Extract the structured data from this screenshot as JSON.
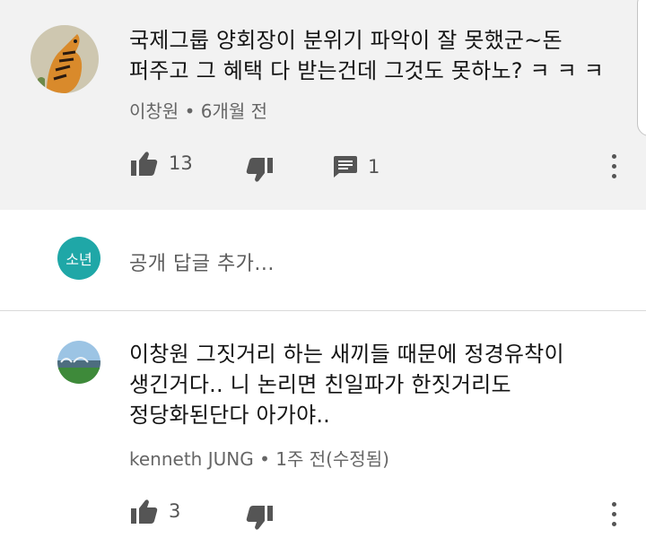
{
  "comment1": {
    "text_line1": "국제그룹 양회장이 분위기 파악이 잘 못했군~돈",
    "text_line2": "퍼주고 그 혜택 다 받는건데 그것도 못하노? ㅋ ㅋ ㅋ",
    "author": "이창원",
    "separator": "•",
    "time": "6개월 전",
    "like_count": "13",
    "reply_count": "1"
  },
  "reply_box": {
    "avatar_text": "소년",
    "placeholder": "공개 답글 추가..."
  },
  "comment2": {
    "text_line1": "이창원 그짓거리 하는 새끼들 때문에 정경유착이",
    "text_line2": "생긴거다.. 니 논리면 친일파가 한짓거리도",
    "text_line3": "정당화된단다 아가야..",
    "author": "kenneth JUNG",
    "separator": "•",
    "time": "1주 전(수정됨)",
    "like_count": "3"
  },
  "colors": {
    "highlight_bg": "#f2f2f2",
    "avatar_teal": "#1fa7a7",
    "icon": "#555555"
  }
}
